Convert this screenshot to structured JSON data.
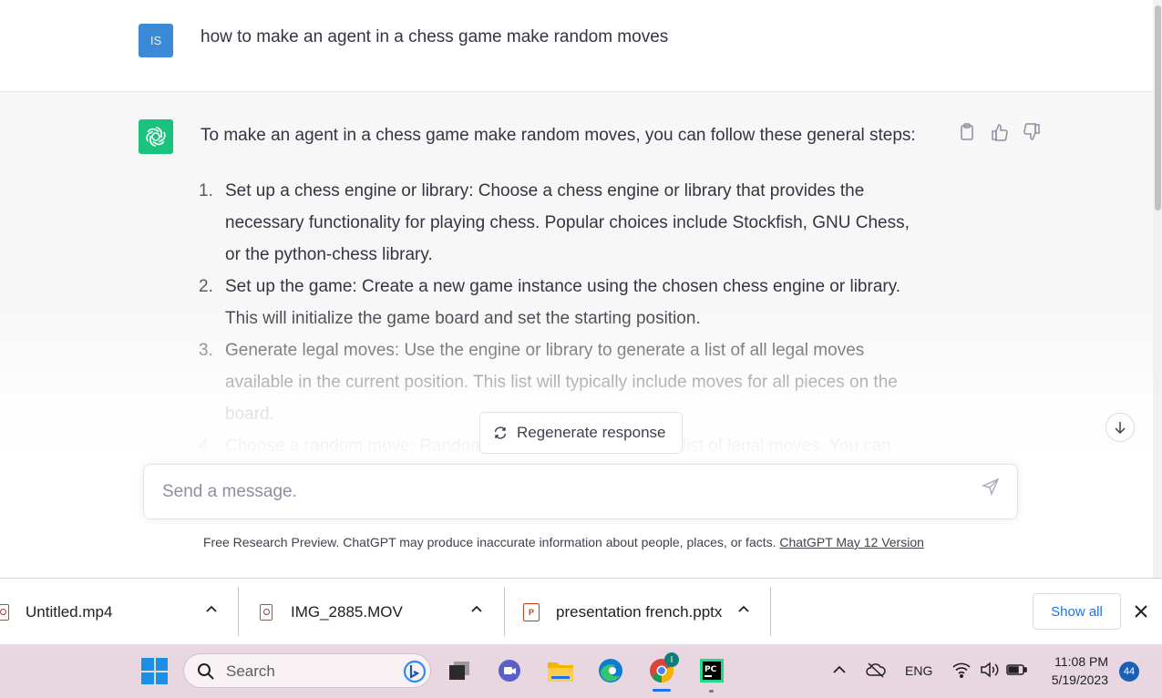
{
  "conversation": {
    "user_avatar": "IS",
    "user_message": "how to make an agent in a chess game make random moves",
    "bot_intro": "To make an agent in a chess game make random moves, you can follow these general steps:",
    "steps": [
      {
        "num": "1.",
        "lines": [
          "Set up a chess engine or library: Choose a chess engine or library that provides the",
          "necessary functionality for playing chess. Popular choices include Stockfish, GNU Chess,",
          "or the python-chess library."
        ]
      },
      {
        "num": "2.",
        "lines": [
          "Set up the game: Create a new game instance using the chosen chess engine or library.",
          "This will initialize the game board and set the starting position."
        ]
      },
      {
        "num": "3.",
        "lines": [
          "Generate legal moves: Use the engine or library to generate a list of all legal moves",
          "available in the current position. This list will typically include moves for all pieces on the",
          "board."
        ]
      },
      {
        "num": "4.",
        "lines": [
          "Choose a random move: Randomly select a move from the list of legal moves. You can"
        ]
      }
    ]
  },
  "regenerate_label": "Regenerate response",
  "composer": {
    "placeholder": "Send a message."
  },
  "disclaimer": {
    "text": "Free Research Preview. ChatGPT may produce inaccurate information about people, places, or facts. ",
    "link": "ChatGPT May 12 Version"
  },
  "downloads": {
    "items": [
      "Untitled.mp4",
      "IMG_2885.MOV",
      "presentation french.pptx"
    ],
    "show_all": "Show all"
  },
  "taskbar": {
    "search_label": "Search",
    "language": "ENG",
    "time": "11:08 PM",
    "date": "5/19/2023",
    "notifications": "44",
    "chrome_badge": "I"
  },
  "colors": {
    "accent": "#19c37d",
    "user_avatar": "#3a8ad8",
    "link": "#1a73e8"
  }
}
